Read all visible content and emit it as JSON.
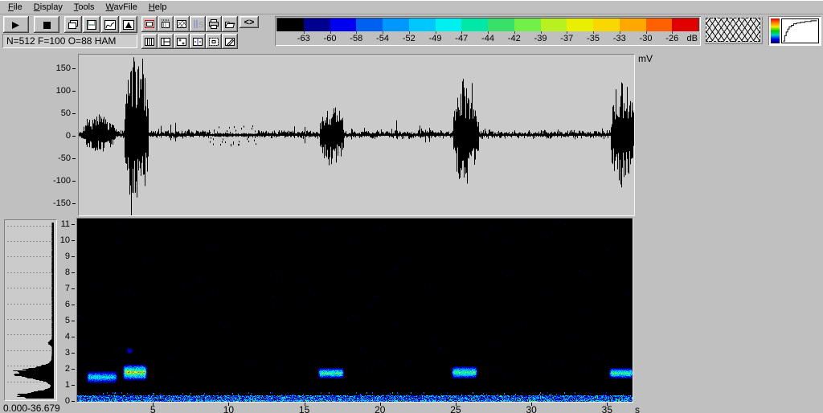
{
  "menu": {
    "items": [
      {
        "label": "File",
        "underline": 0
      },
      {
        "label": "Display",
        "underline": 0
      },
      {
        "label": "Tools",
        "underline": 0
      },
      {
        "label": "WavFile",
        "underline": 0
      },
      {
        "label": "Help",
        "underline": 0
      }
    ]
  },
  "toolbar": {
    "status_value": "N=512 F=100 O=88 HAM",
    "transport": [
      {
        "name": "play-button",
        "glyph": "play"
      },
      {
        "name": "stop-button",
        "glyph": "stop"
      }
    ],
    "view_buttons": [
      {
        "name": "cascade-windows-button",
        "glyph": "cascade"
      },
      {
        "name": "save-button",
        "glyph": "save"
      },
      {
        "name": "waveform-view-button",
        "glyph": "wave"
      },
      {
        "name": "spectrum-view-button",
        "glyph": "peak"
      }
    ],
    "row1_buttons": [
      {
        "name": "active-window-button",
        "glyph": "redwin"
      },
      {
        "name": "marker-ruler-button",
        "glyph": "ruler"
      },
      {
        "name": "spectrogram-window-button",
        "glyph": "hatchwin"
      },
      {
        "name": "sample-rate-button",
        "glyph": "fs"
      },
      {
        "name": "print-button",
        "glyph": "printer"
      },
      {
        "name": "open-file-button",
        "glyph": "folder"
      }
    ],
    "scroll_button": {
      "name": "scroll-arrows-button",
      "label": "<>"
    },
    "row2_buttons": [
      {
        "name": "layout-vertical-bars-button",
        "glyph": "bars"
      },
      {
        "name": "layout-left-column-button",
        "glyph": "leftcol"
      },
      {
        "name": "layout-cross-markers-button",
        "glyph": "crossgrid"
      },
      {
        "name": "layout-cursor-line-button",
        "glyph": "cursor"
      },
      {
        "name": "layout-inner-frame-button",
        "glyph": "innerbox"
      },
      {
        "name": "annotate-button",
        "glyph": "pencil"
      }
    ],
    "db_scale": {
      "unit": "dB",
      "labels": [
        "-63",
        "-60",
        "-58",
        "-54",
        "-52",
        "-49",
        "-47",
        "-44",
        "-42",
        "-39",
        "-37",
        "-35",
        "-33",
        "-30",
        "-26"
      ],
      "colors": [
        "#000000",
        "#000090",
        "#0000F0",
        "#0060F0",
        "#0098FF",
        "#00C8FF",
        "#00F0F0",
        "#00E8A8",
        "#38E068",
        "#70F048",
        "#B8F020",
        "#E8F000",
        "#F8D800",
        "#FFA800",
        "#FF6000",
        "#E00000"
      ]
    },
    "texture_box": {
      "name": "texture-pattern-box"
    },
    "palette_box": {
      "name": "palette-curve-box"
    }
  },
  "waveform": {
    "unit": "mV",
    "yticks": [
      150,
      100,
      50,
      0,
      -50,
      -100,
      -150
    ],
    "duration_s": 36.679,
    "segments": [
      {
        "t0": 0.25,
        "t1": 2.4,
        "amp_mv": 42,
        "type": "burst"
      },
      {
        "t0": 3.0,
        "t1": 4.6,
        "amp_mv": 168,
        "type": "burst"
      },
      {
        "t0": 8.6,
        "t1": 11.8,
        "amp_mv": 22,
        "type": "dots"
      },
      {
        "t0": 15.9,
        "t1": 17.5,
        "amp_mv": 72,
        "type": "burst"
      },
      {
        "t0": 24.7,
        "t1": 26.4,
        "amp_mv": 112,
        "type": "burst"
      },
      {
        "t0": 35.1,
        "t1": 36.679,
        "amp_mv": 122,
        "type": "burst"
      }
    ],
    "baseline_noise_mv": 5
  },
  "spectrogram": {
    "x_unit": "s",
    "xticks": [
      5,
      10,
      15,
      20,
      25,
      30,
      35
    ],
    "yticks": [
      11,
      10,
      9,
      8,
      7,
      6,
      5,
      4,
      3,
      2,
      1,
      0
    ],
    "duration_s": 36.679,
    "calls": [
      {
        "t0": 0.7,
        "t1": 2.5,
        "f_low": 1.1,
        "f_high": 1.8,
        "strength": 7
      },
      {
        "t0": 3.1,
        "t1": 4.5,
        "f_low": 1.3,
        "f_high": 2.2,
        "strength": 11
      },
      {
        "t0": 3.3,
        "t1": 3.6,
        "f_low": 2.9,
        "f_high": 3.3,
        "strength": 3
      },
      {
        "t0": 16.0,
        "t1": 17.5,
        "f_low": 1.4,
        "f_high": 2.0,
        "strength": 9
      },
      {
        "t0": 24.8,
        "t1": 26.3,
        "f_low": 1.4,
        "f_high": 2.1,
        "strength": 9
      },
      {
        "t0": 35.2,
        "t1": 36.679,
        "f_low": 1.4,
        "f_high": 2.0,
        "strength": 9
      }
    ],
    "blob_palette": [
      "#000040",
      "#000090",
      "#0010E0",
      "#0060FF",
      "#00A0FF",
      "#00E0FF",
      "#00F0B0",
      "#30F060",
      "#A0F030",
      "#F0F000",
      "#FFA000",
      "#FF3000"
    ],
    "noise_strip": true
  },
  "histogram": {
    "range_label": "0.000-36.679",
    "peaks": [
      {
        "f": 1.55,
        "w": 0.42,
        "h": 0.88
      },
      {
        "f": 0.12,
        "w": 0.3,
        "h": 0.75
      },
      {
        "f": 3.5,
        "w": 0.15,
        "h": 0.1
      }
    ]
  }
}
